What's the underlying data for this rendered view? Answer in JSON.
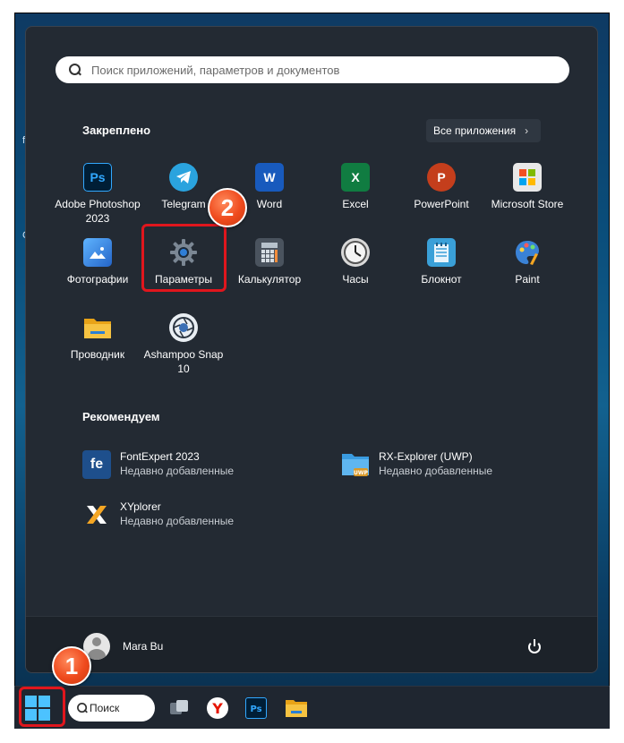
{
  "search": {
    "placeholder": "Поиск приложений, параметров и документов"
  },
  "pinned": {
    "title": "Закреплено",
    "all_apps_label": "Все приложения",
    "apps": [
      {
        "label": "Adobe Photoshop 2023",
        "icon": "photoshop-icon",
        "glyph": "Ps",
        "color": "#001e36"
      },
      {
        "label": "Telegram",
        "icon": "telegram-icon",
        "glyph": "",
        "color": "#2aa3de"
      },
      {
        "label": "Word",
        "icon": "word-icon",
        "glyph": "W",
        "color": "#185abd"
      },
      {
        "label": "Excel",
        "icon": "excel-icon",
        "glyph": "X",
        "color": "#107c41"
      },
      {
        "label": "PowerPoint",
        "icon": "powerpoint-icon",
        "glyph": "P",
        "color": "#c43e1c"
      },
      {
        "label": "Microsoft Store",
        "icon": "store-icon",
        "glyph": "",
        "color": "#e8e8e8"
      },
      {
        "label": "Фотографии",
        "icon": "photos-icon",
        "glyph": "",
        "color": "#3b8fe0"
      },
      {
        "label": "Параметры",
        "icon": "gear-icon",
        "glyph": "⚙",
        "color": "#5a6470"
      },
      {
        "label": "Калькулятор",
        "icon": "calculator-icon",
        "glyph": "",
        "color": "#606a75"
      },
      {
        "label": "Часы",
        "icon": "clock-icon",
        "glyph": "",
        "color": "#d9d9d9"
      },
      {
        "label": "Блокнот",
        "icon": "notepad-icon",
        "glyph": "",
        "color": "#3aa0d8"
      },
      {
        "label": "Paint",
        "icon": "paint-icon",
        "glyph": "",
        "color": "#3a82d6"
      },
      {
        "label": "Проводник",
        "icon": "folder-icon",
        "glyph": "",
        "color": "#f6c342"
      },
      {
        "label": "Ashampoo Snap 10",
        "icon": "ashampoo-snap-icon",
        "glyph": "",
        "color": "#e9eef3"
      }
    ]
  },
  "recommended": {
    "title": "Рекомендуем",
    "items": [
      {
        "name": "FontExpert 2023",
        "sub": "Недавно добавленные",
        "icon": "fontexpert-icon",
        "glyph": "fe",
        "color": "#1e4f8c"
      },
      {
        "name": "RX-Explorer (UWP)",
        "sub": "Недавно добавленные",
        "icon": "rx-explorer-icon",
        "glyph": "",
        "color": "#3a9be0"
      },
      {
        "name": "XYplorer",
        "sub": "Недавно добавленные",
        "icon": "xyplorer-icon",
        "glyph": "✕",
        "color": "#232a33"
      }
    ]
  },
  "user": {
    "name": "Mara Bu"
  },
  "taskbar": {
    "search_label": "Поиск"
  },
  "badges": {
    "one": "1",
    "two": "2"
  },
  "colors": {
    "highlight": "#e0161d",
    "accent": "#4cc2ff",
    "menu_bg": "#232a33"
  }
}
